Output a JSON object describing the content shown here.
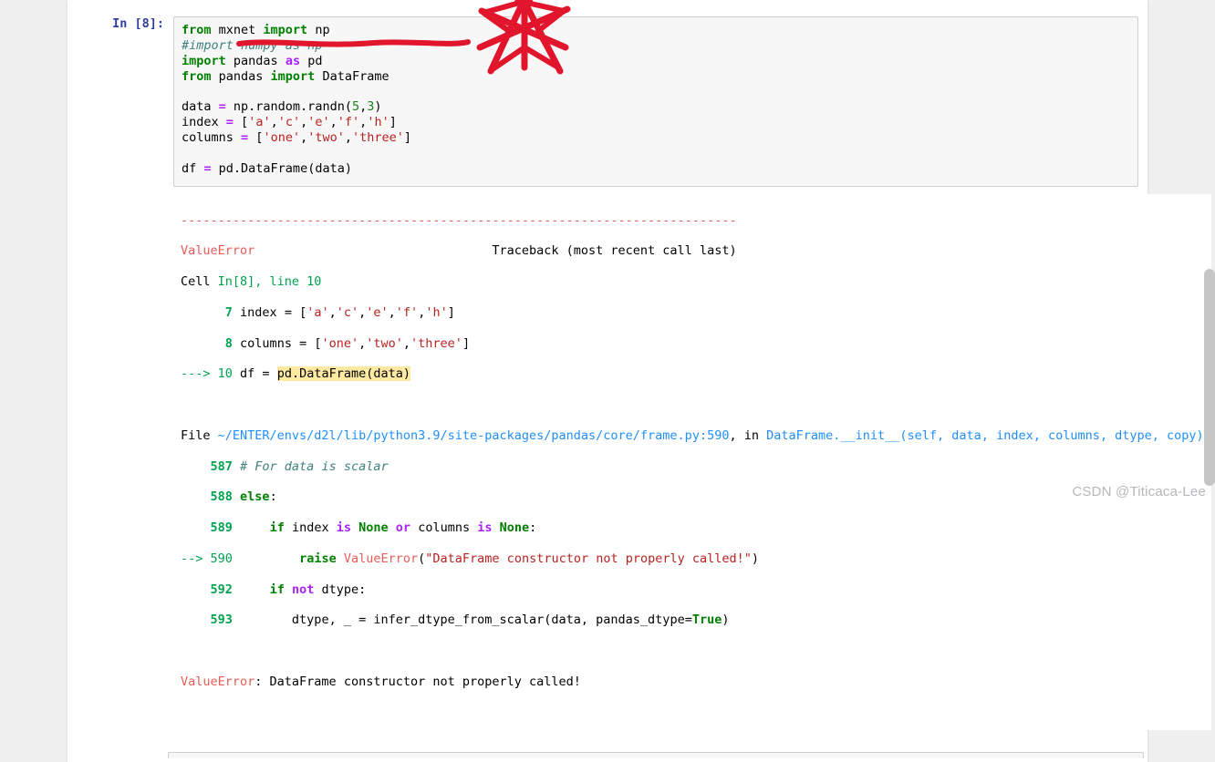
{
  "prompt": {
    "in_label": "In [8]:"
  },
  "code": {
    "l1_from": "from",
    "l1_mxnet": " mxnet ",
    "l1_import": "import",
    "l1_np": " np",
    "l2_comment": "#import numpy as np",
    "l3_import": "import",
    "l3_pandas": " pandas ",
    "l3_as": "as",
    "l3_pd": " pd",
    "l4_from": "from",
    "l4_pandas": " pandas ",
    "l4_import": "import",
    "l4_df": " DataFrame",
    "l6_data": "data ",
    "l6_eq": "=",
    "l6_rhs1": " np.random.randn",
    "l6_p1": "(",
    "l6_5": "5",
    "l6_c": ",",
    "l6_3": "3",
    "l6_p2": ")",
    "l7_index": "index ",
    "l7_eq": "=",
    "l7_b1": " [",
    "l7_a": "'a'",
    "l7_c1": ",",
    "l7_c": "'c'",
    "l7_c2": ",",
    "l7_e": "'e'",
    "l7_c3": ",",
    "l7_f": "'f'",
    "l7_c4": ",",
    "l7_h": "'h'",
    "l7_b2": "]",
    "l8_cols": "columns ",
    "l8_eq": "=",
    "l8_b1": " [",
    "l8_one": "'one'",
    "l8_c1": ",",
    "l8_two": "'two'",
    "l8_c2": ",",
    "l8_three": "'three'",
    "l8_b2": "]",
    "l10_df": "df ",
    "l10_eq": "=",
    "l10_rhs": " pd.DataFrame(data)"
  },
  "tb": {
    "dashline": "---------------------------------------------------------------------------",
    "err_name": "ValueError",
    "tb_label": "                                Traceback (most recent call last)",
    "cell_lbl": "Cell ",
    "cell_ref": "In[8], line 10",
    "n7": "7",
    "t7_a": " index = [",
    "t7_s1": "'a'",
    "t7_c1": ",",
    "t7_s2": "'c'",
    "t7_c2": ",",
    "t7_s3": "'e'",
    "t7_c3": ",",
    "t7_s4": "'f'",
    "t7_c4": ",",
    "t7_s5": "'h'",
    "t7_b2": "]",
    "n8": "8",
    "t8_a": " columns = [",
    "t8_s1": "'one'",
    "t8_c1": ",",
    "t8_s2": "'two'",
    "t8_c2": ",",
    "t8_s3": "'three'",
    "t8_b2": "]",
    "arrow10": "---> ",
    "n10": "10",
    "t10_a": " df = ",
    "t10_pd": "pd",
    "t10_dot": ".",
    "t10_call": "DataFrame(data)",
    "file_lbl": "File ",
    "file_path": "~/ENTER/envs/d2l/lib/python3.9/site-packages/pandas/core/frame.py:590",
    "file_in": ", in ",
    "sig1": "DataFrame.__init__",
    "sig2": "(self, data, index, columns, dtype, copy)",
    "n587": "587",
    "t587": " # For data is scalar",
    "n588": "588",
    "t588_else": "else",
    "t588_colon": ":",
    "n589": "589",
    "t589_pad": "    ",
    "t589_if": "if",
    "t589_idx": " index ",
    "t589_is": "is",
    "t589_sp": " ",
    "t589_none1": "None",
    "t589_sp2": " ",
    "t589_or": "or",
    "t589_cols": " columns ",
    "t589_is2": "is",
    "t589_sp3": " ",
    "t589_none2": "None",
    "t589_colon": ":",
    "arrow590": "--> ",
    "n590": "590",
    "t590_pad": "        ",
    "t590_raise": "raise",
    "t590_sp": " ",
    "t590_ve": "ValueError",
    "t590_p1": "(",
    "t590_msg": "\"DataFrame constructor not properly called!\"",
    "t590_p2": ")",
    "n592": "592",
    "t592_pad": "    ",
    "t592_if": "if",
    "t592_sp": " ",
    "t592_not": "not",
    "t592_dtype": " dtype:",
    "n593": "593",
    "t593_body1": "        dtype, _ = infer_dtype_from_scalar(data, pandas_dtype=",
    "t593_true": "True",
    "t593_body2": ")",
    "final_err": "ValueError",
    "final_msg": ": DataFrame constructor not properly called!"
  },
  "watermark": "CSDN @Titicaca-Lee"
}
